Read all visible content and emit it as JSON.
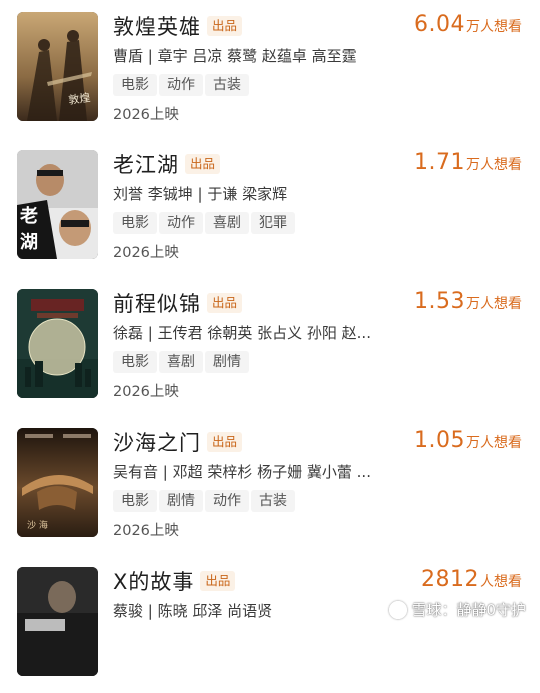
{
  "movies": [
    {
      "title": "敦煌英雄",
      "badge": "出品",
      "cast": "曹盾 | 章宇 吕凉 蔡鹭 赵蕴卓 高至霆",
      "tags": [
        "电影",
        "动作",
        "古装"
      ],
      "release": "2026上映",
      "want_count": "6.04",
      "want_unit": "万人想看",
      "poster_palette": [
        "#3b2a1c",
        "#8a6a43",
        "#c9a775"
      ]
    },
    {
      "title": "老江湖",
      "badge": "出品",
      "cast": "刘誉 李铖坤 | 于谦 梁家辉",
      "tags": [
        "电影",
        "动作",
        "喜剧",
        "犯罪"
      ],
      "release": "2026上映",
      "want_count": "1.71",
      "want_unit": "万人想看",
      "poster_palette": [
        "#111111",
        "#f2f2f2",
        "#b78b68"
      ]
    },
    {
      "title": "前程似锦",
      "badge": "出品",
      "cast": "徐磊 | 王传君 徐朝英 张占义 孙阳 赵...",
      "tags": [
        "电影",
        "喜剧",
        "剧情"
      ],
      "release": "2026上映",
      "want_count": "1.53",
      "want_unit": "万人想看",
      "poster_palette": [
        "#1e3a34",
        "#2f5a4f",
        "#c9c6a5"
      ]
    },
    {
      "title": "沙海之门",
      "badge": "出品",
      "cast": "吴有音 | 邓超 荣梓杉 杨子姗 冀小蕾 ...",
      "tags": [
        "电影",
        "剧情",
        "动作",
        "古装"
      ],
      "release": "2026上映",
      "want_count": "1.05",
      "want_unit": "万人想看",
      "poster_palette": [
        "#1d140d",
        "#6b4a2c",
        "#c08c55"
      ]
    },
    {
      "title": "X的故事",
      "badge": "出品",
      "cast": "蔡骏 | 陈晓 邱泽 尚语贤",
      "tags": [],
      "release": "",
      "want_count": "2812",
      "want_unit": "人想看",
      "poster_palette": [
        "#2a2a2a",
        "#5a5a5a",
        "#d9d9d9"
      ]
    }
  ],
  "watermark": "雪球：静静0守护",
  "colors": {
    "accent": "#d96b1e",
    "badge_bg": "#fbf1e6",
    "tag_bg": "#f4f4f4"
  }
}
